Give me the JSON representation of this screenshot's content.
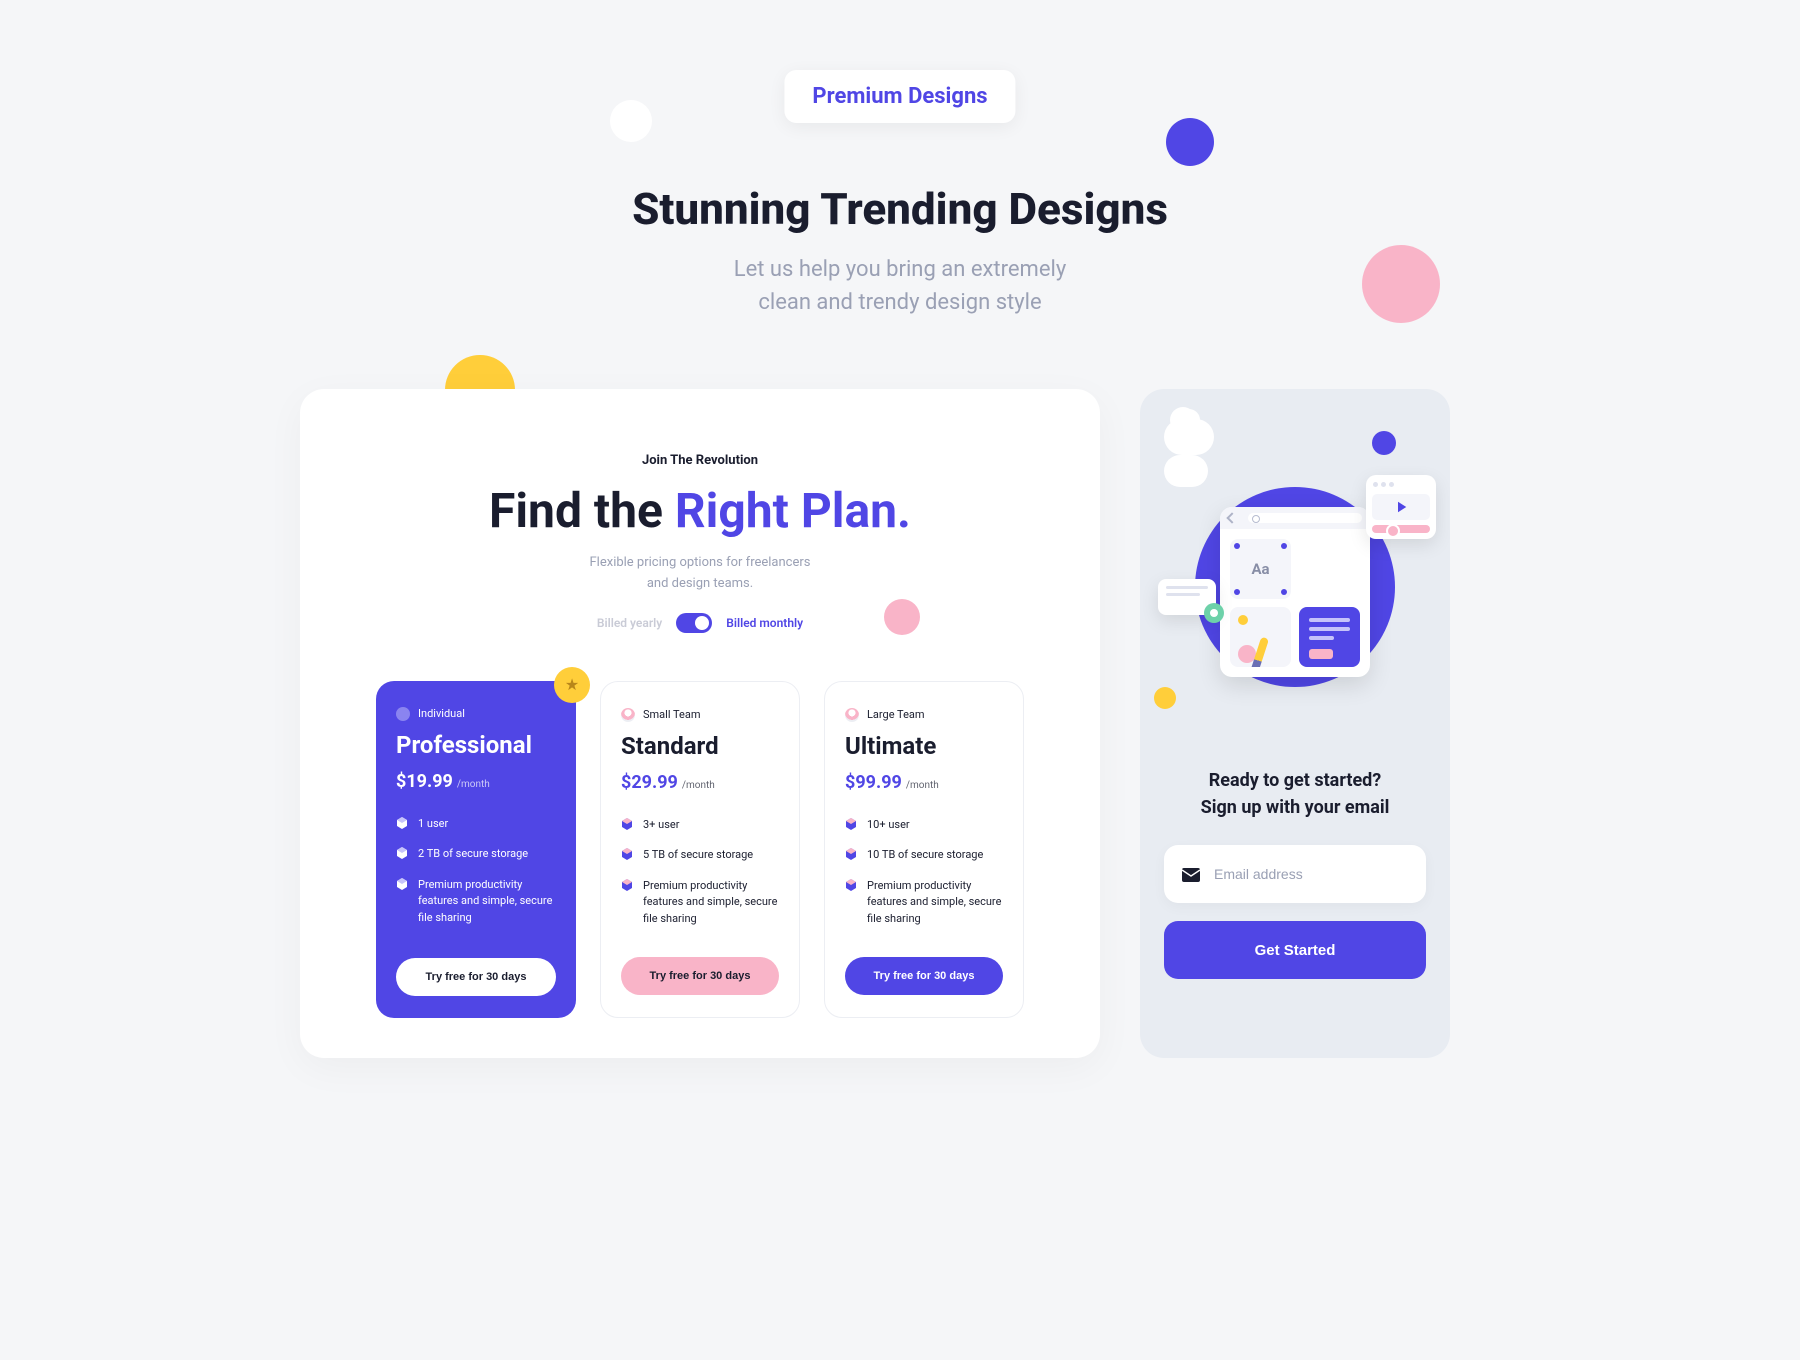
{
  "badge": "Premium Designs",
  "hero": {
    "title": "Stunning Trending Designs",
    "subtitle_line1": "Let us help you bring an extremely",
    "subtitle_line2": "clean and trendy design style"
  },
  "pricing": {
    "eyebrow": "Join The Revolution",
    "title_lead": "Find the ",
    "title_accent": "Right Plan.",
    "subtitle_line1": "Flexible pricing options for freelancers",
    "subtitle_line2": "and design teams.",
    "billing": {
      "yearly": "Billed yearly",
      "monthly": "Billed monthly",
      "active": "monthly"
    },
    "plans": [
      {
        "tier": "Individual",
        "name": "Professional",
        "price": "$19.99",
        "period": "/month",
        "features": [
          "1 user",
          "2 TB of secure storage",
          "Premium productivity features and simple, secure file sharing"
        ],
        "cta": "Try free for 30 days",
        "featured": true
      },
      {
        "tier": "Small Team",
        "name": "Standard",
        "price": "$29.99",
        "period": "/month",
        "features": [
          "3+ user",
          "5 TB of secure storage",
          "Premium productivity features and simple, secure file sharing"
        ],
        "cta": "Try free for 30 days",
        "featured": false
      },
      {
        "tier": "Large Team",
        "name": "Ultimate",
        "price": "$99.99",
        "period": "/month",
        "features": [
          "10+ user",
          "10 TB of secure storage",
          "Premium productivity features and simple, secure file sharing"
        ],
        "cta": "Try free for 30 days",
        "featured": false
      }
    ]
  },
  "signup": {
    "title_line1": "Ready to get started?",
    "title_line2": "Sign up with your email",
    "placeholder": "Email address",
    "button": "Get Started",
    "illus_aa": "Aa"
  },
  "colors": {
    "accent": "#5046e5",
    "pink": "#f9b4c8",
    "yellow": "#ffce3a"
  }
}
